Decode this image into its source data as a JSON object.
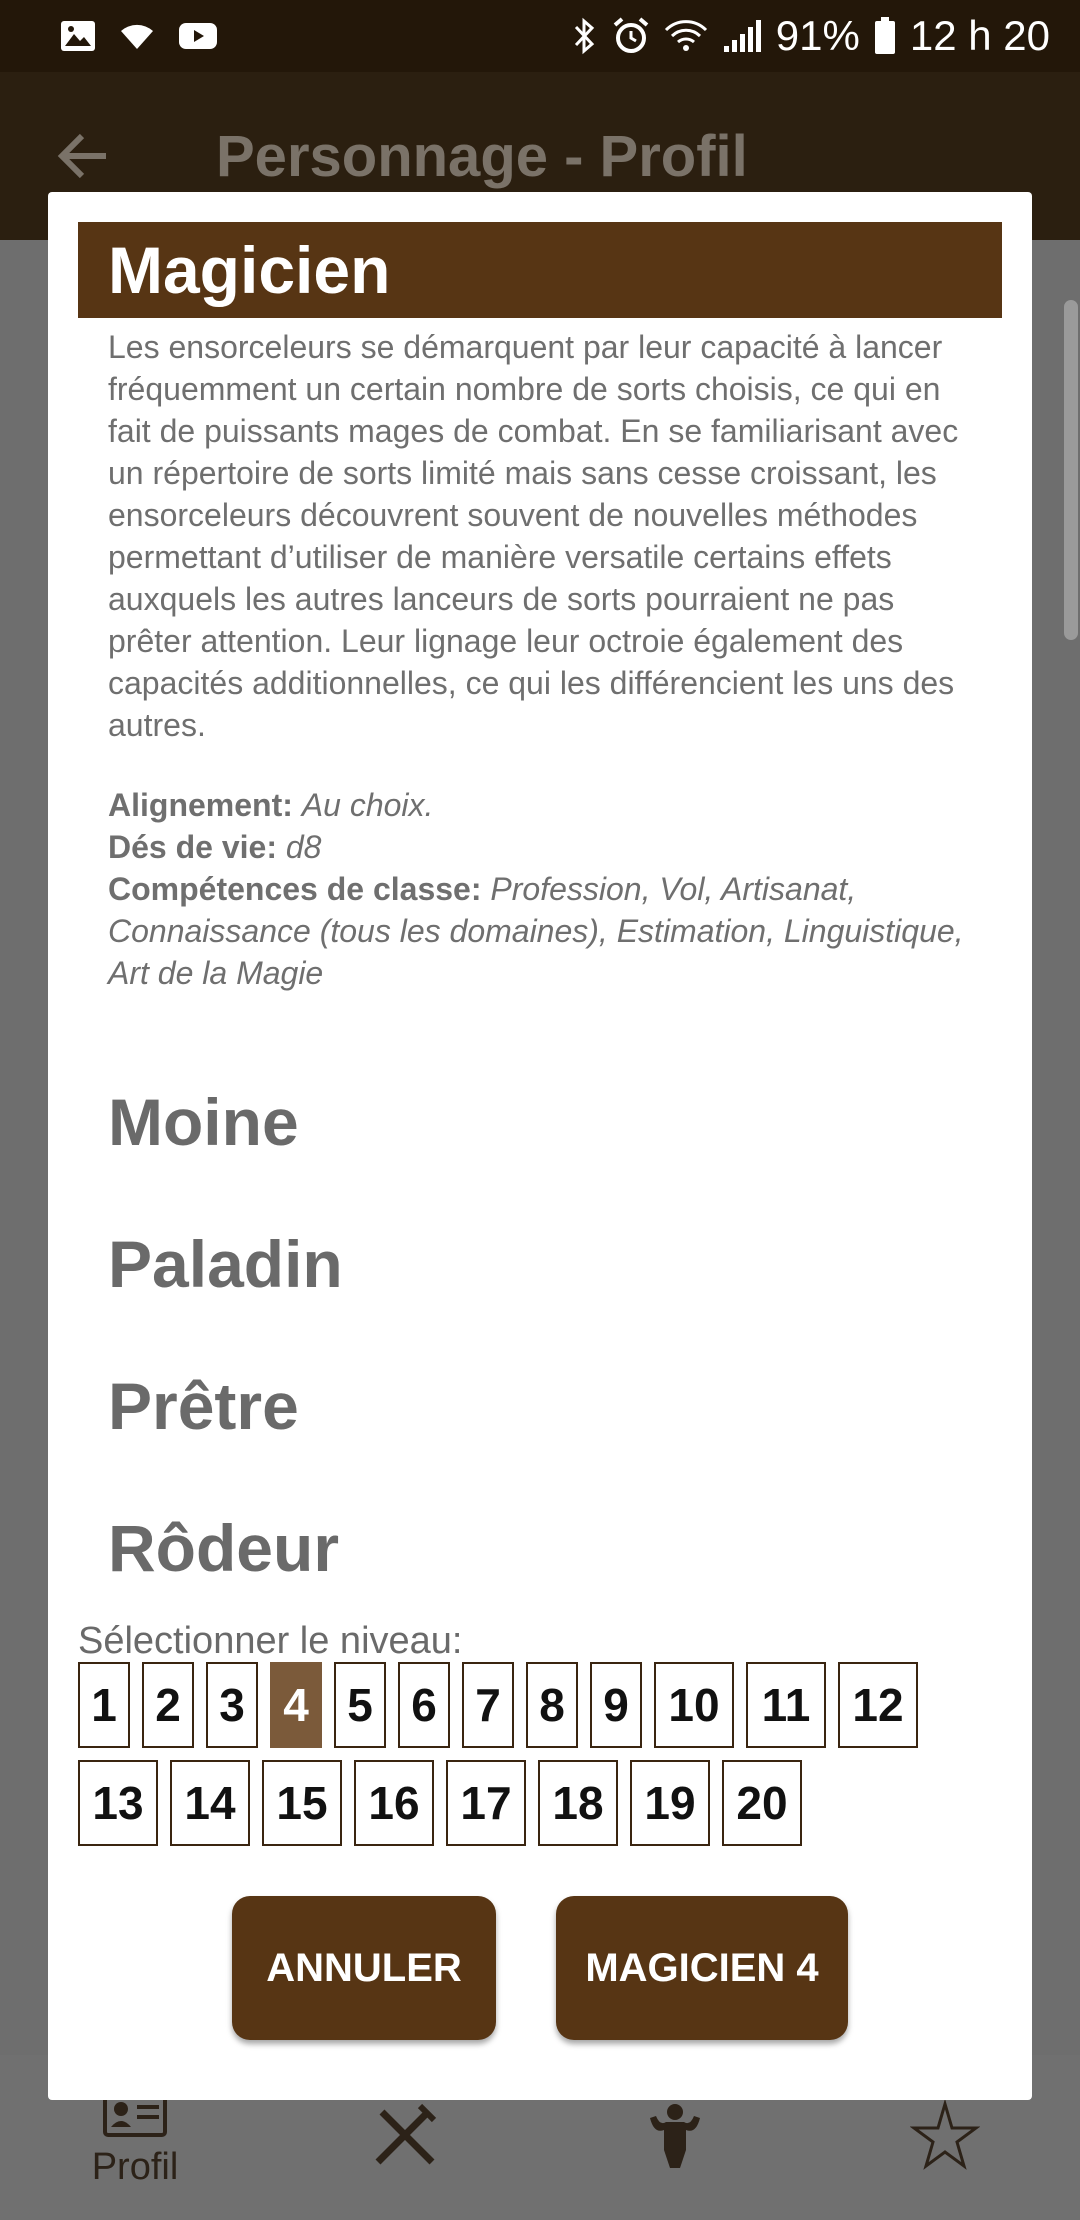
{
  "status_bar": {
    "battery": "91%",
    "time": "12 h 20",
    "left_icons": [
      "image-icon",
      "wifi-icon",
      "youtube-icon"
    ],
    "right_icons": [
      "bluetooth-icon",
      "alarm-icon",
      "wifi-data-icon",
      "signal-icon",
      "battery-icon"
    ]
  },
  "app_bar": {
    "title": "Personnage - Profil",
    "back_icon": "arrow-back-icon"
  },
  "dialog": {
    "class_name": "Magicien",
    "description": "Les ensorceleurs se démarquent par leur capacité à lancer fréquemment un certain nombre de sorts choisis, ce qui en fait de puissants mages de combat. En se familiarisant avec un répertoire de sorts limité mais sans cesse croissant, les ensorceleurs découvrent souvent de nouvelles méthodes permettant d’utiliser de manière versatile certains effets auxquels les autres lanceurs de sorts pourraient ne pas prêter attention. Leur lignage leur octroie également des capacités additionnelles, ce qui les différencient les uns des autres.",
    "alignment_label": "Alignement:",
    "alignment_value": "Au choix.",
    "hit_dice_label": "Dés de vie:",
    "hit_dice_value": "d8",
    "skills_label": "Compétences de classe:",
    "skills_value": "Profession, Vol, Artisanat, Connaissance (tous les domaines), Estimation, Linguistique, Art de la Magie",
    "other_classes": [
      "Moine",
      "Paladin",
      "Prêtre",
      "Rôdeur"
    ],
    "level_label": "Sélectionner le niveau:",
    "levels_row1": [
      "1",
      "2",
      "3",
      "4",
      "5",
      "6",
      "7",
      "8",
      "9",
      "10",
      "11",
      "12"
    ],
    "levels_row2": [
      "13",
      "14",
      "15",
      "16",
      "17",
      "18",
      "19",
      "20"
    ],
    "selected_level": "4",
    "cancel_label": "ANNULER",
    "confirm_label": "MAGICIEN 4"
  },
  "bottom_nav": {
    "items": [
      {
        "label": "Profil",
        "icon": "profile-card-icon"
      },
      {
        "label": "",
        "icon": "crossed-weapons-icon"
      },
      {
        "label": "",
        "icon": "strongman-icon"
      },
      {
        "label": "",
        "icon": "star-magic-icon"
      }
    ]
  },
  "colors": {
    "accent_brown": "#573514",
    "selected_level_bg": "#7b5a3a",
    "status_bar_bg": "#231709"
  }
}
